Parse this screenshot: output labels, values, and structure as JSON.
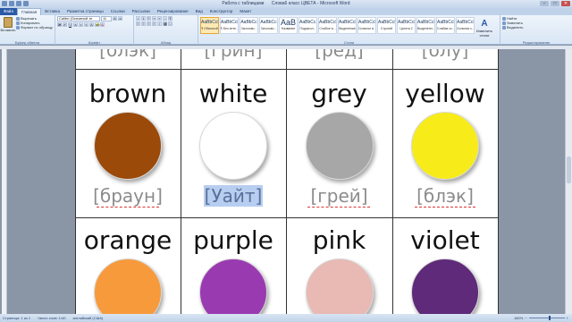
{
  "window": {
    "title": "Слова6 класс ЦВЕТА - Microsoft Word",
    "context_tab": "Работа с таблицами"
  },
  "tabs": [
    {
      "label": "Файл"
    },
    {
      "label": "Главная"
    },
    {
      "label": "Вставка"
    },
    {
      "label": "Разметка страницы"
    },
    {
      "label": "Ссылки"
    },
    {
      "label": "Рассылки"
    },
    {
      "label": "Рецензирование"
    },
    {
      "label": "Вид"
    },
    {
      "label": "Конструктор"
    },
    {
      "label": "Макет"
    }
  ],
  "ribbon": {
    "clipboard": {
      "label": "Буфер обмена",
      "paste": "Вставить",
      "cut": "Вырезать",
      "copy": "Копировать",
      "format": "Формат по образцу"
    },
    "font": {
      "label": "Шрифт",
      "name": "Calibri (Основной те",
      "size": "11"
    },
    "paragraph": {
      "label": "Абзац"
    },
    "styles": {
      "label": "Стили",
      "items": [
        {
          "sample": "AaBbCcDc",
          "name": "¶ Обычный"
        },
        {
          "sample": "AaBbCcDc",
          "name": "¶ Без инте..."
        },
        {
          "sample": "AaBbCc",
          "name": "Заголово..."
        },
        {
          "sample": "AaBbCc",
          "name": "Заголово..."
        },
        {
          "sample": "AaB",
          "name": "Название"
        },
        {
          "sample": "AaBbCc.",
          "name": "Подзагол..."
        },
        {
          "sample": "AaBbCcDc",
          "name": "Слабое в..."
        },
        {
          "sample": "AaBbCcDc",
          "name": "Выделение"
        },
        {
          "sample": "AaBbCcDc",
          "name": "Сильное в..."
        },
        {
          "sample": "AaBbCcDc",
          "name": "Строгий"
        },
        {
          "sample": "AaBbCcDc",
          "name": "Цитата 2"
        },
        {
          "sample": "AaBbCcDc",
          "name": "Выделенн..."
        },
        {
          "sample": "AaBbCcDc",
          "name": "Слабая сс..."
        },
        {
          "sample": "AaBbCcDc",
          "name": "Сильная с..."
        }
      ],
      "change": "Изменить стили"
    },
    "editing": {
      "label": "Редактирование",
      "find": "Найти",
      "replace": "Заменить",
      "select": "Выделить"
    }
  },
  "table": {
    "top_row": [
      "[блэк]",
      "[грин]",
      "[ред]",
      "[блу]"
    ],
    "row1": [
      {
        "word": "brown",
        "translit": "[браун]",
        "color": "#9b4a0a"
      },
      {
        "word": "white",
        "translit": "[Уайт]",
        "color": "#ffffff"
      },
      {
        "word": "grey",
        "translit": "[грей]",
        "color": "#a7a7a7"
      },
      {
        "word": "yellow",
        "translit": "[блэк]",
        "color": "#f7ec1a"
      }
    ],
    "row2": [
      {
        "word": "orange",
        "color": "#f79a3c"
      },
      {
        "word": "purple",
        "color": "#9a3ab0"
      },
      {
        "word": "pink",
        "color": "#e9b9b3"
      },
      {
        "word": "violet",
        "color": "#5e2a79"
      }
    ]
  },
  "statusbar": {
    "page": "Страница: 1 из 1",
    "words": "Число слов: 1/40",
    "lang": "английский (США)",
    "zoom": "180%"
  }
}
